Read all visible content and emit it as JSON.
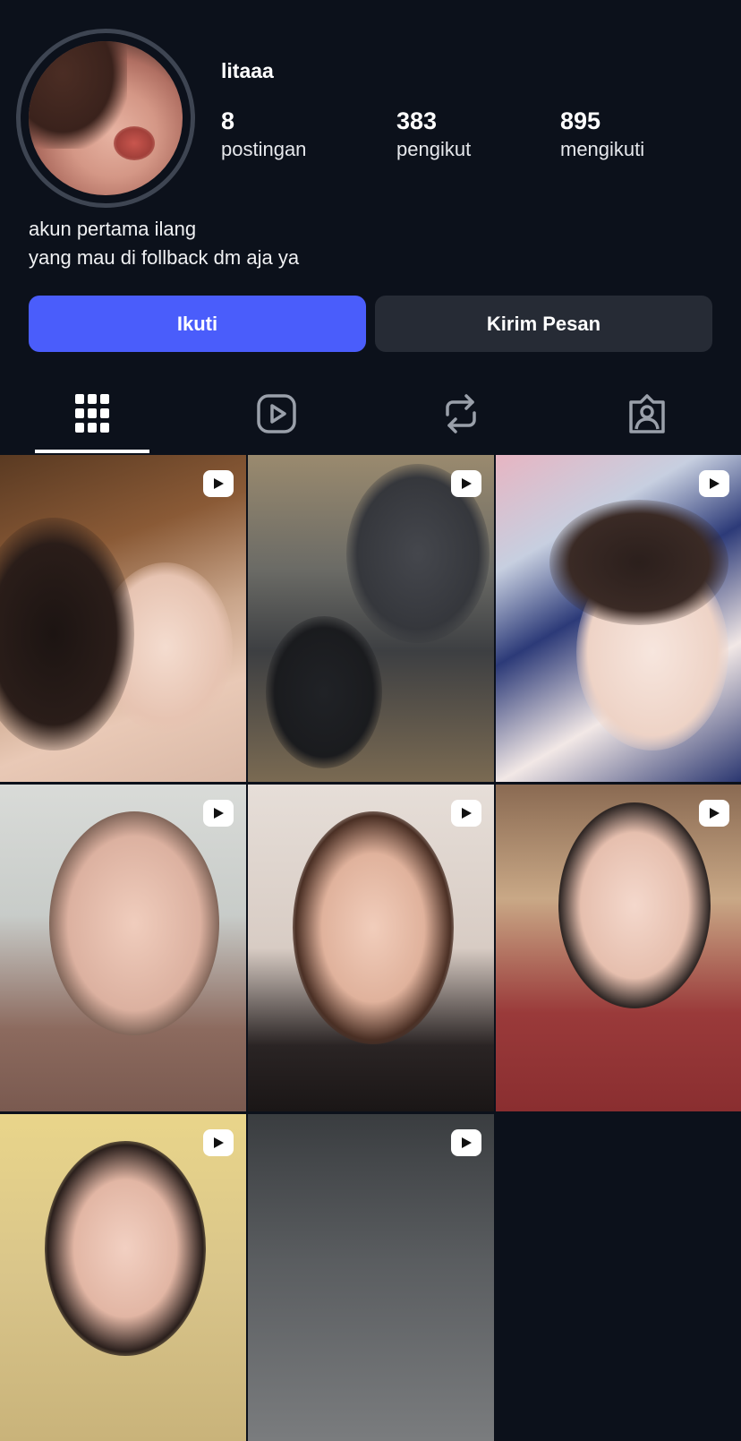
{
  "profile": {
    "username": "litaaa",
    "stats": [
      {
        "value": "8",
        "label": "postingan"
      },
      {
        "value": "383",
        "label": "pengikut"
      },
      {
        "value": "895",
        "label": "mengikuti"
      }
    ],
    "bio_line1": "akun pertama ilang",
    "bio_line2": "yang mau di follback dm aja ya"
  },
  "actions": {
    "follow_label": "Ikuti",
    "message_label": "Kirim Pesan"
  },
  "tabs": [
    {
      "icon": "grid-icon",
      "active": true
    },
    {
      "icon": "reels-icon",
      "active": false
    },
    {
      "icon": "repost-icon",
      "active": false
    },
    {
      "icon": "tagged-icon",
      "active": false
    }
  ],
  "posts": [
    {
      "type": "video"
    },
    {
      "type": "video"
    },
    {
      "type": "video"
    },
    {
      "type": "video"
    },
    {
      "type": "video"
    },
    {
      "type": "video"
    },
    {
      "type": "video"
    },
    {
      "type": "video"
    }
  ],
  "colors": {
    "background": "#0c111b",
    "follow_button": "#4a5dfb",
    "message_button": "#262b35"
  }
}
